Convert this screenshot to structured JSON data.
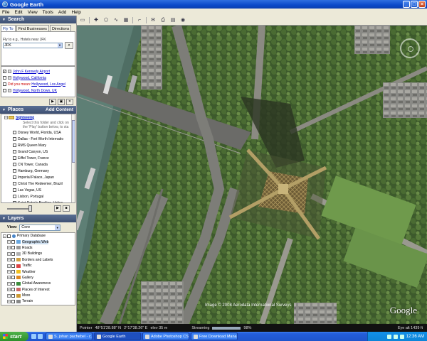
{
  "window": {
    "title": "Google Earth"
  },
  "menu": [
    "File",
    "Edit",
    "View",
    "Tools",
    "Add",
    "Help"
  ],
  "search": {
    "header": "Search",
    "tabs": [
      "Fly To",
      "Find Businesses",
      "Directions"
    ],
    "flyto_label": "Fly to e.g., Hotels near JFK",
    "flyto_value": "JFK",
    "results": [
      {
        "label": "John F Kennedy Airport",
        "checked": true
      },
      {
        "label": "Hollywood, California",
        "checked": false
      },
      {
        "prefix": "Did you mean:",
        "label": "Hollywood, Los Angel",
        "checked": false
      },
      {
        "label": "Hollywood, North Down, UK",
        "checked": false
      }
    ]
  },
  "places": {
    "header": "Places",
    "add_content": "Add Content",
    "folder": "Sightseeing",
    "folder_desc": [
      "Select this folder and click on",
      "the 'Play' button below, to sta"
    ],
    "items": [
      "Disney World, Florida, USA",
      "Dallas - Fort Worth Internatio",
      "RMS Queen Mary",
      "Grand Canyon, US",
      "Eiffel Tower, France",
      "CN Tower, Canada",
      "Hamburg, Germany",
      "Imperial Palace, Japan",
      "Christ The Redeemer, Brazil",
      "Las Vegas, US",
      "Lisbon, Portugal",
      "Saint Peter's Basilica, Vatica"
    ]
  },
  "layers": {
    "header": "Layers",
    "view_label": "View:",
    "view_value": "Core",
    "root": "Primary Database",
    "items": [
      {
        "label": "Geographic Web",
        "color": "#6aa8e0",
        "highlight": true
      },
      {
        "label": "Roads",
        "color": "#999999"
      },
      {
        "label": "3D Buildings",
        "color": "#b0b0b0"
      },
      {
        "label": "Borders and Labels",
        "color": "#d0a040"
      },
      {
        "label": "Traffic",
        "color": "#dd4444"
      },
      {
        "label": "Weather",
        "color": "#f0c020"
      },
      {
        "label": "Gallery",
        "color": "#dd8822"
      },
      {
        "label": "Global Awareness",
        "color": "#3c8c3c"
      },
      {
        "label": "Places of Interest",
        "color": "#cc6666"
      },
      {
        "label": "More",
        "color": "#cc9933"
      },
      {
        "label": "Terrain",
        "color": "#888888"
      }
    ]
  },
  "map": {
    "copyright": "Image © 2008 Aerodata International Surveys",
    "logo": "Google",
    "status": {
      "pointer_label": "Pointer",
      "lat": "48°51'28.88\" N",
      "lon": "2°17'38.26\" E",
      "elev": "elev   35 m",
      "streaming_label": "Streaming",
      "streaming_pct": "98%",
      "streaming_fraction": 0.98,
      "eye_alt": "Eye alt   1439 ft"
    }
  },
  "taskbar": {
    "start": "start",
    "tasks": [
      "S. johan pachebel - c...",
      "Google Earth",
      "Adobe Photoshop CS3",
      "Free Download Mana..."
    ],
    "active_task": 1,
    "clock": "12:36 AM"
  }
}
